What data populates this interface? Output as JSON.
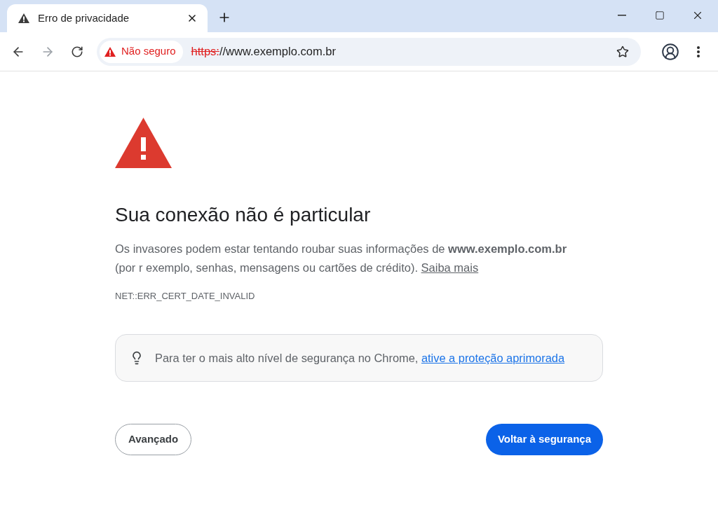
{
  "tabs": [
    {
      "title": "Erro de privacidade",
      "selected": true
    }
  ],
  "nav_buttons": [
    {
      "kind": "back",
      "disabled": false
    },
    {
      "kind": "forward",
      "disabled": true
    },
    {
      "kind": "reload",
      "disabled": false
    }
  ],
  "address_bar": {
    "security_chip": "Não seguro",
    "scheme": "https:",
    "address": "//www.exemplo.com.br"
  },
  "page": {
    "heading": "Sua conexão não é particular",
    "description": "Os invasores podem estar tentando roubar suas informações de **www.exemplo.com.br** (por r exemplo, senhas, mensagens ou cartões de crédito).",
    "learn_more_link": "Saiba mais",
    "error_code": "NET::ERR_CERT_DATE_INVALID",
    "tip": {
      "text": "Para ter o mais alto nível de segurança no Chrome,",
      "link": "ative a proteção aprimorada"
    },
    "buttons": [
      {
        "label": "Avançado",
        "kind": "secondary"
      },
      {
        "label": "Voltar à segurança",
        "kind": "primary"
      }
    ]
  }
}
